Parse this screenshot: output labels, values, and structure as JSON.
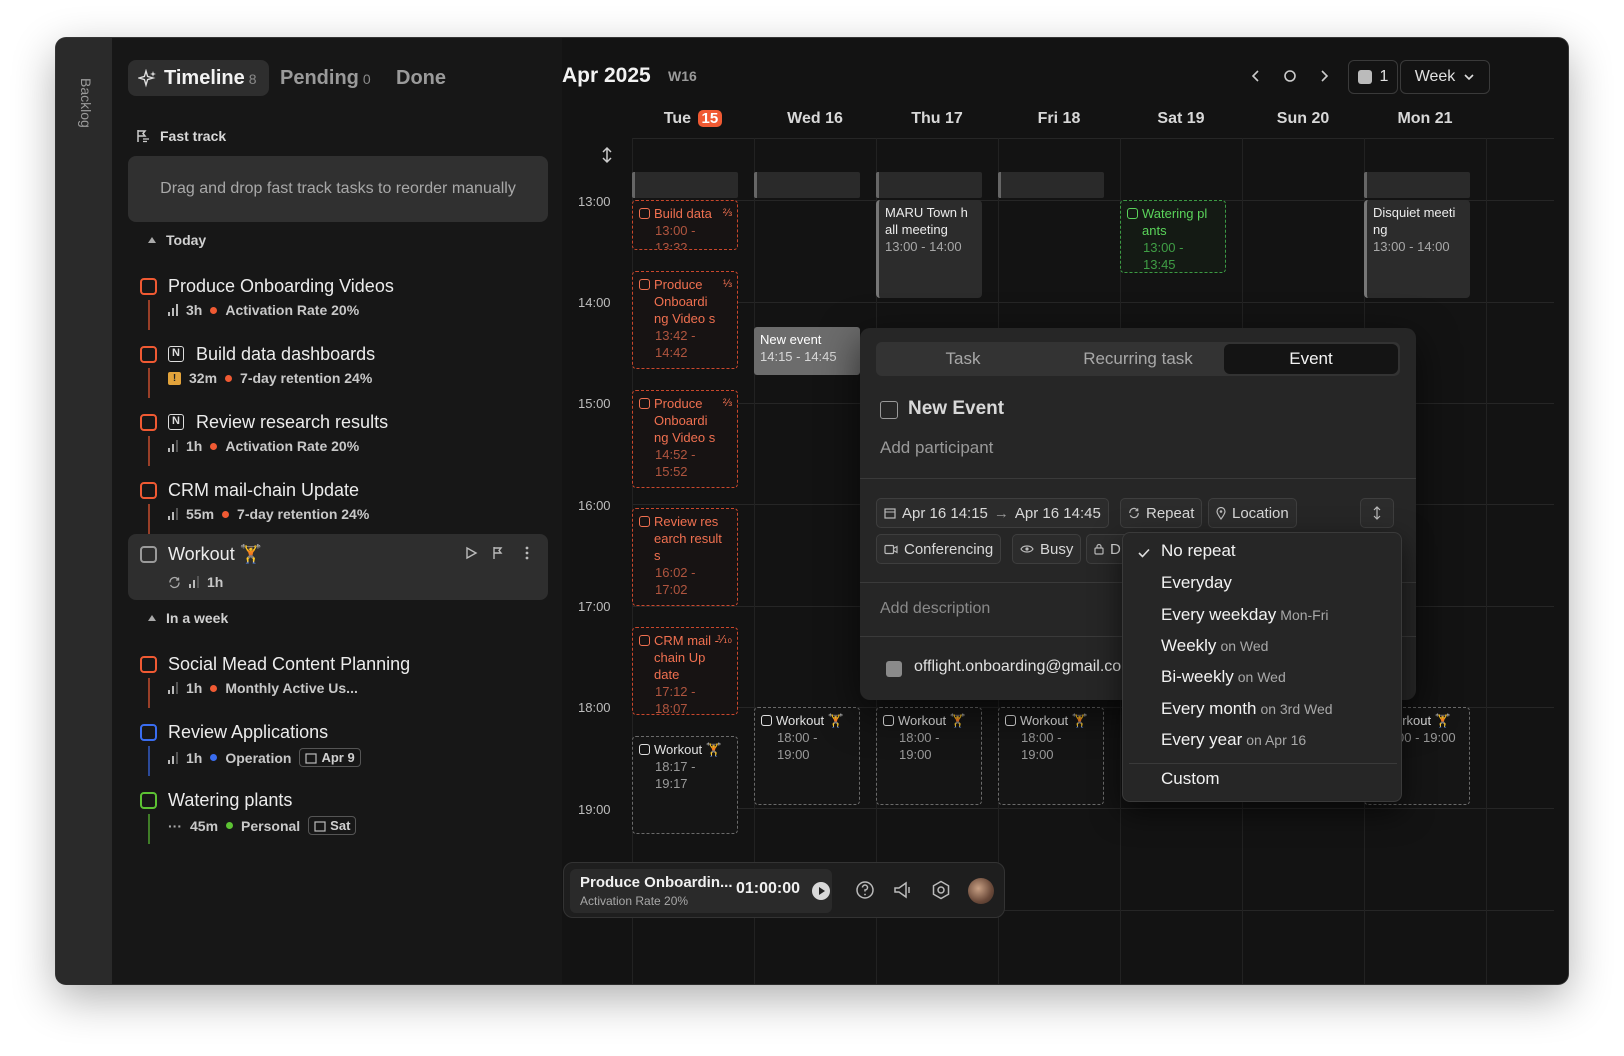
{
  "sidebar": {
    "backlog_label": "Backlog"
  },
  "left": {
    "tabs": [
      {
        "label": "Timeline",
        "count": "8"
      },
      {
        "label": "Pending",
        "count": "0"
      },
      {
        "label": "Done",
        "count": ""
      }
    ],
    "fast_track": {
      "label": "Fast track",
      "placeholder": "Drag and drop fast track tasks to reorder manually"
    },
    "today": {
      "label": "Today",
      "tasks": [
        {
          "title": "Produce Onboarding Videos",
          "duration": "3h",
          "goal": "Activation Rate 20%"
        },
        {
          "title": "Build data dashboards",
          "duration": "32m",
          "goal": "7-day retention 24%"
        },
        {
          "title": "Review research results",
          "duration": "1h",
          "goal": "Activation Rate 20%"
        },
        {
          "title": "CRM mail-chain Update",
          "duration": "55m",
          "goal": "7-day retention 24%"
        },
        {
          "title": "Workout 🏋️",
          "duration": "1h",
          "goal": ""
        }
      ]
    },
    "week": {
      "label": "In a week",
      "tasks": [
        {
          "title": "Social Mead Content Planning",
          "duration": "1h",
          "goal": "Monthly Active Us...",
          "date": ""
        },
        {
          "title": "Review Applications",
          "duration": "1h",
          "goal": "Operation",
          "date": "Apr 9"
        },
        {
          "title": "Watering plants",
          "duration": "45m",
          "goal": "Personal",
          "date": "Sat"
        }
      ]
    }
  },
  "calendar": {
    "month": "Apr 2025",
    "week": "W16",
    "calendars_count": "1",
    "view": "Week",
    "days": [
      {
        "name": "Tue",
        "num": "15"
      },
      {
        "name": "Wed",
        "num": "16"
      },
      {
        "name": "Thu",
        "num": "17"
      },
      {
        "name": "Fri",
        "num": "18"
      },
      {
        "name": "Sat",
        "num": "19"
      },
      {
        "name": "Sun",
        "num": "20"
      },
      {
        "name": "Mon",
        "num": "21"
      }
    ],
    "hours": [
      "13:00",
      "14:00",
      "15:00",
      "16:00",
      "17:00",
      "18:00",
      "19:00"
    ],
    "events": {
      "build": {
        "title": "Build data",
        "frac": "⅔",
        "time": "13:00 - 13:32"
      },
      "prod1": {
        "title": "Produce Onboardi ng Video s",
        "frac": "⅓",
        "time": "13:42 - 14:42"
      },
      "prod2": {
        "title": "Produce Onboardi ng Video s",
        "frac": "⅔",
        "time": "14:52 - 15:52"
      },
      "review": {
        "title": "Review res earch result s",
        "time": "16:02 - 17:02"
      },
      "crm": {
        "title": "CRM mail -chain Up date",
        "frac": "⅒",
        "time": "17:12 - 18:07"
      },
      "workout_tue": {
        "title": "Workout 🏋️",
        "time": "18:17 - 19:17"
      },
      "maru": {
        "title": "MARU Town h all meeting",
        "time": "13:00 - 14:00"
      },
      "watering": {
        "title": "Watering pl ants",
        "time": "13:00 - 13:45"
      },
      "disquiet": {
        "title": "Disquiet meeti ng",
        "time": "13:00 - 14:00"
      },
      "newev": {
        "title": "New event",
        "time": "14:15 - 14:45"
      },
      "workout_wed": {
        "title": "Workout 🏋️",
        "time": "18:00 - 19:00"
      },
      "workout_thu": {
        "title": "Workout 🏋️",
        "time": "18:00 - 19:00"
      },
      "workout_fri": {
        "title": "Workout 🏋️",
        "time": "18:00 - 19:00"
      },
      "workout_mon": {
        "title": "orkout 🏋️",
        "time": "00 - 19:00"
      }
    }
  },
  "popup": {
    "tabs": [
      "Task",
      "Recurring task",
      "Event"
    ],
    "title": "New Event",
    "participant_placeholder": "Add participant",
    "date_start": "Apr 16  14:15",
    "date_end": "Apr 16  14:45",
    "repeat": "Repeat",
    "location": "Location",
    "conferencing": "Conferencing",
    "busy": "Busy",
    "privacy_letter": "D",
    "description_placeholder": "Add description",
    "email": "offlight.onboarding@gmail.co"
  },
  "repeat_menu": {
    "items": [
      {
        "label": "No repeat",
        "hint": ""
      },
      {
        "label": "Everyday",
        "hint": ""
      },
      {
        "label": "Every weekday",
        "hint": "Mon-Fri"
      },
      {
        "label": "Weekly",
        "hint": "on Wed"
      },
      {
        "label": "Bi-weekly",
        "hint": "on Wed"
      },
      {
        "label": "Every month",
        "hint": "on 3rd Wed"
      },
      {
        "label": "Every year",
        "hint": "on Apr 16"
      },
      {
        "label": "Custom",
        "hint": ""
      }
    ]
  },
  "player": {
    "title": "Produce Onboardin...",
    "goal": "Activation Rate 20%",
    "time": "01:00:00"
  },
  "colors": {
    "accent": "#f05a33",
    "blue": "#3a6df0",
    "green": "#5cc233"
  }
}
